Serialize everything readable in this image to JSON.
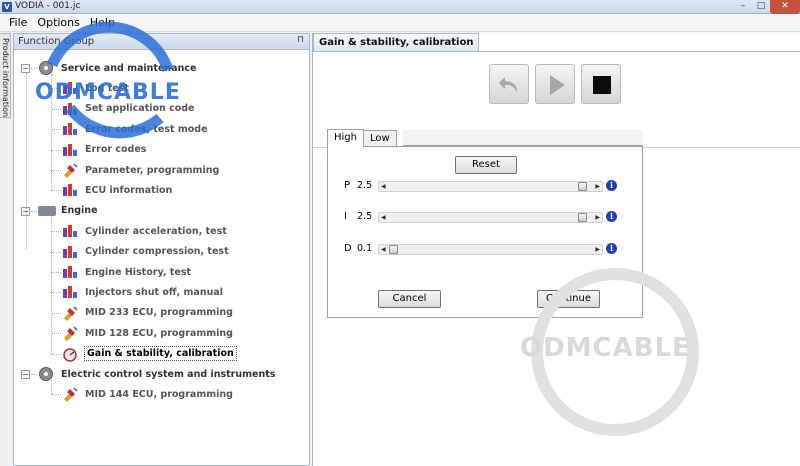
{
  "window": {
    "title": "VODIA - 001.jc",
    "minimize": "–",
    "maximize": "□",
    "close": "✕",
    "icon": "vodia-app-icon"
  },
  "menu": {
    "items": [
      "File",
      "Options",
      "Help"
    ]
  },
  "side_strip": {
    "label": "Product information"
  },
  "function_group": {
    "title": "Function Group",
    "pin": "⊓",
    "groups": [
      {
        "label": "Service and maintenance",
        "icon": "wrench-person-icon",
        "items": [
          {
            "label": "Log test",
            "icon": "bar-chart-icon"
          },
          {
            "label": "Set application code",
            "icon": "bar-chart-icon"
          },
          {
            "label": "Error codes, test mode",
            "icon": "bar-chart-icon"
          },
          {
            "label": "Error codes",
            "icon": "bar-chart-icon"
          },
          {
            "label": "Parameter, programming",
            "icon": "plug-icon"
          },
          {
            "label": "ECU information",
            "icon": "bar-chart-icon"
          }
        ]
      },
      {
        "label": "Engine",
        "icon": "engine-icon",
        "items": [
          {
            "label": "Cylinder acceleration, test",
            "icon": "bar-chart-icon"
          },
          {
            "label": "Cylinder compression, test",
            "icon": "bar-chart-icon"
          },
          {
            "label": "Engine History, test",
            "icon": "bar-chart-icon"
          },
          {
            "label": "Injectors shut off, manual",
            "icon": "bar-chart-icon"
          },
          {
            "label": "MID 233 ECU, programming",
            "icon": "plug-icon"
          },
          {
            "label": "MID 128 ECU, programming",
            "icon": "plug-icon"
          },
          {
            "label": "Gain & stability, calibration",
            "icon": "gauge-icon",
            "selected": true
          }
        ]
      },
      {
        "label": "Electric control system and instruments",
        "icon": "gear-person-icon",
        "items": [
          {
            "label": "MID 144 ECU, programming",
            "icon": "plug-icon"
          }
        ]
      }
    ]
  },
  "document": {
    "tab_title": "Gain & stability, calibration",
    "toolbar": {
      "back": "back-arrow-icon",
      "play": "play-icon",
      "stop": "stop-icon"
    },
    "param_tabs": [
      "High",
      "Low"
    ],
    "reset_label": "Reset",
    "params": [
      {
        "name": "P",
        "value": "2.5",
        "fraction": 0.98
      },
      {
        "name": "I",
        "value": "2.5",
        "fraction": 0.98
      },
      {
        "name": "D",
        "value": "0.1",
        "fraction": 0.0
      }
    ],
    "info_glyph": "i",
    "cancel_label": "Cancel",
    "continue_label": "Continue"
  },
  "watermark": {
    "text": "ODMCABLE"
  },
  "colors": {
    "accent_blue": "#1f3fb0",
    "watermark_blue": "#2b6fd6",
    "selection_bg": "#ffffff"
  }
}
